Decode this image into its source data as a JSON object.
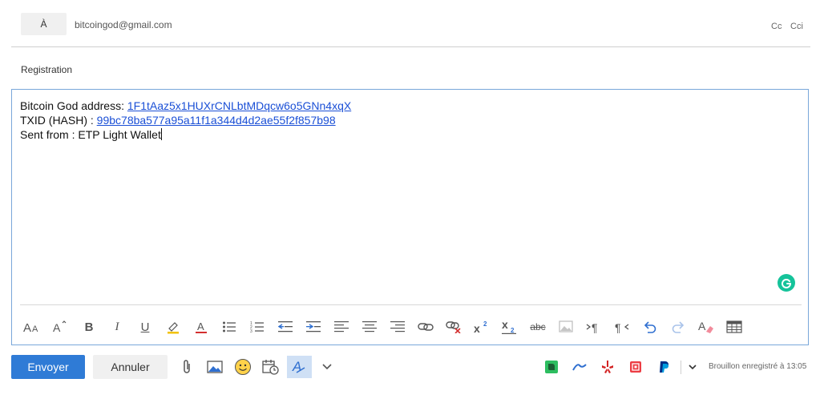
{
  "header": {
    "to_label": "À",
    "to_value": "bitcoingod@gmail.com",
    "cc_label": "Cc",
    "cci_label": "Cci"
  },
  "subject": "Registration",
  "body": {
    "line1_prefix": "Bitcoin God address: ",
    "line1_link": "1F1tAaz5x1HUXrCNLbtMDqcw6o5GNn4xqX ",
    "line2_prefix": "TXID (HASH) : ",
    "line2_link": "99bc78ba577a95a11f1a344d4d2ae55f2f857b98",
    "line3": "Sent from : ETP Light Wallet"
  },
  "format_toolbar": [
    "font-size-icon",
    "grow-font-icon",
    "bold-icon",
    "italic-icon",
    "underline-icon",
    "highlight-icon",
    "font-color-icon",
    "bullet-list-icon",
    "numbered-list-icon",
    "decrease-indent-icon",
    "increase-indent-icon",
    "align-left-icon",
    "align-center-icon",
    "align-right-icon",
    "insert-link-icon",
    "remove-link-icon",
    "superscript-icon",
    "subscript-icon",
    "strikethrough-icon",
    "picture-icon",
    "ltr-icon",
    "rtl-icon",
    "undo-icon",
    "redo-icon",
    "clear-formatting-icon",
    "insert-table-icon"
  ],
  "actions": {
    "send_label": "Envoyer",
    "cancel_label": "Annuler"
  },
  "status": {
    "draft_saved": "Brouillon enregistré à 13:05"
  },
  "colors": {
    "accent": "#2f7bd6",
    "link": "#1a4fd6",
    "grammarly": "#15c39a",
    "evernote": "#2dbe60",
    "yelp": "#d32323",
    "paypal": "#003087"
  }
}
